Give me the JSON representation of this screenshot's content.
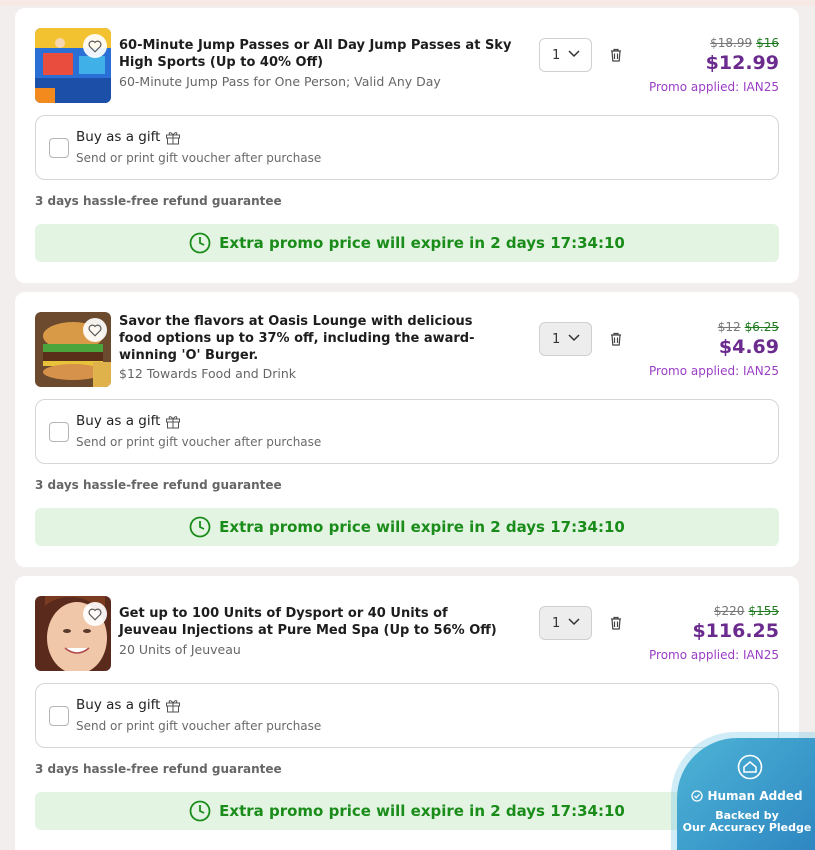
{
  "items": [
    {
      "title": "60-Minute Jump Passes or All Day Jump Passes at Sky High Sports (Up to 40% Off)",
      "subtitle": "60-Minute Jump Pass for One Person; Valid Any Day",
      "quantity": "1",
      "price_original": "$18.99",
      "price_discounted": "$16",
      "price_final": "$12.99",
      "promo": "Promo applied: IAN25",
      "gift_label": "Buy as a gift",
      "gift_sub": "Send or print gift voucher after purchase",
      "refund": "3 days hassle-free refund guarantee",
      "banner": "Extra promo price will expire in 2 days 17:34:10"
    },
    {
      "title": "Savor the flavors at Oasis Lounge with delicious food options up to 37% off, including the award-winning 'O' Burger.",
      "subtitle": "$12 Towards Food and Drink",
      "quantity": "1",
      "price_original": "$12",
      "price_discounted": "$6.25",
      "price_final": "$4.69",
      "promo": "Promo applied: IAN25",
      "gift_label": "Buy as a gift",
      "gift_sub": "Send or print gift voucher after purchase",
      "refund": "3 days hassle-free refund guarantee",
      "banner": "Extra promo price will expire in 2 days 17:34:10"
    },
    {
      "title": "Get up to 100 Units of Dysport or 40 Units of Jeuveau Injections at Pure Med Spa (Up to 56% Off)",
      "subtitle": "20 Units of Jeuveau",
      "quantity": "1",
      "price_original": "$220",
      "price_discounted": "$155",
      "price_final": "$116.25",
      "promo": "Promo applied: IAN25",
      "gift_label": "Buy as a gift",
      "gift_sub": "Send or print gift voucher after purchase",
      "refund": "3 days hassle-free refund guarantee",
      "banner": "Extra promo price will expire in 2 days 17:34:10"
    }
  ],
  "badge": {
    "line1": "Human Added",
    "line2": "Backed by",
    "line3": "Our Accuracy Pledge"
  },
  "colors": {
    "price_final": "#6a2a8e",
    "promo": "#9a3ec4",
    "discount": "#1f7a1f",
    "banner_bg": "#e4f4e2",
    "banner_text": "#1a8c1a"
  }
}
